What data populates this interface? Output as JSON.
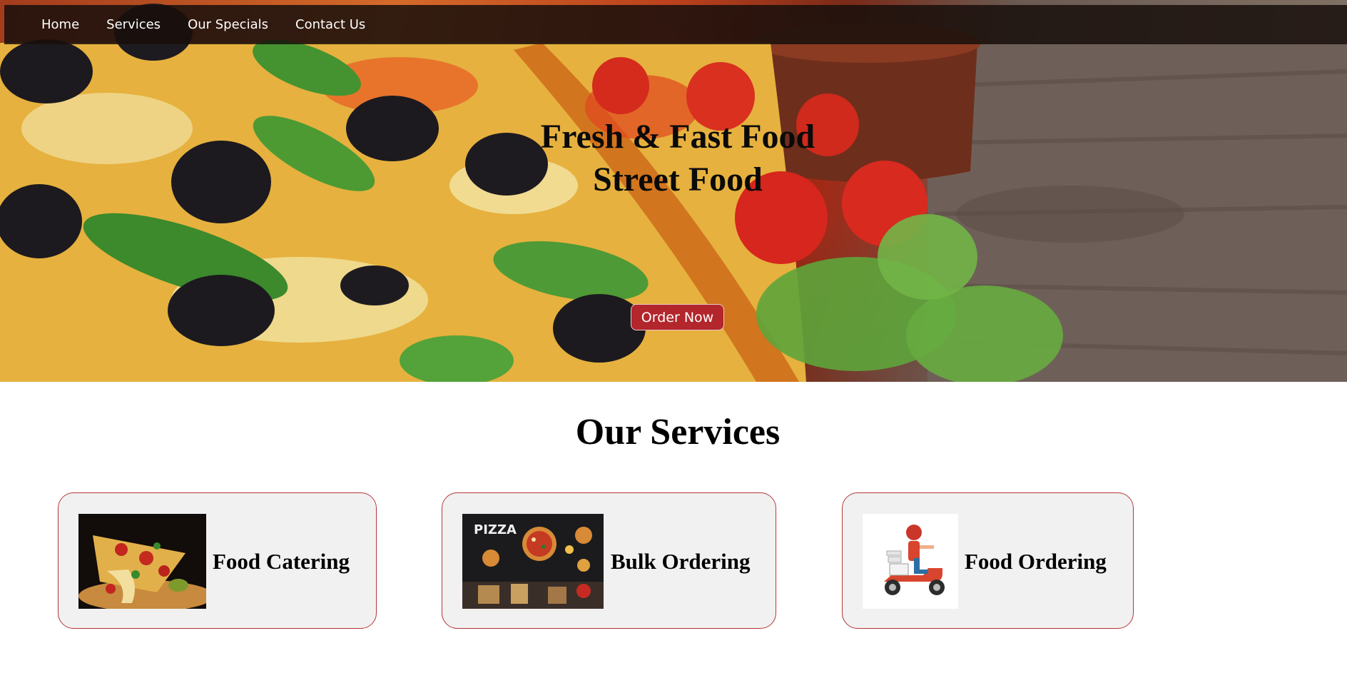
{
  "nav": {
    "items": [
      {
        "label": "Home"
      },
      {
        "label": "Services"
      },
      {
        "label": "Our Specials"
      },
      {
        "label": "Contact Us"
      }
    ]
  },
  "hero": {
    "title_line1": "Fresh & Fast Food",
    "title_line2": "Street Food",
    "cta_label": "Order Now"
  },
  "services": {
    "heading": "Our Services",
    "cards": [
      {
        "label": "Food Catering",
        "image": "pizza-slice-photo"
      },
      {
        "label": "Bulk Ordering",
        "image": "pizza-chalkboard-photo"
      },
      {
        "label": "Food Ordering",
        "image": "delivery-scooter-illustration"
      }
    ]
  },
  "colors": {
    "accent": "#b2262c",
    "card_border": "#b5373b",
    "card_bg": "#f1f1f1",
    "navbar_bg": "#190f0c"
  }
}
